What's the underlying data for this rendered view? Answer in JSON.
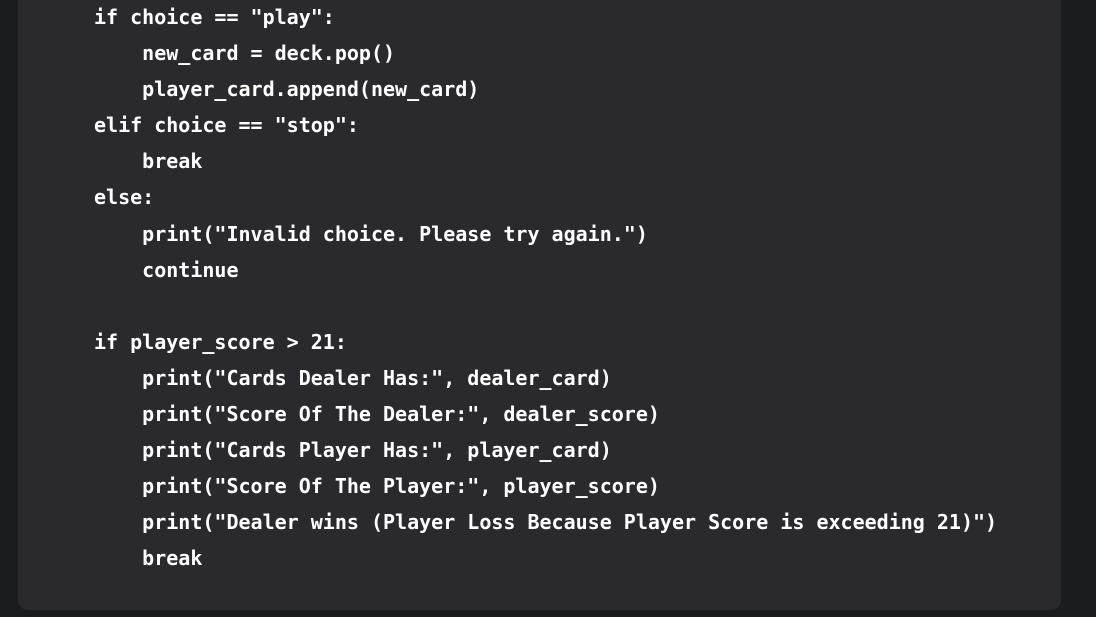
{
  "code": {
    "lines": [
      "if choice == \"play\":",
      "    new_card = deck.pop()",
      "    player_card.append(new_card)",
      "elif choice == \"stop\":",
      "    break",
      "else:",
      "    print(\"Invalid choice. Please try again.\")",
      "    continue",
      "",
      "if player_score > 21:",
      "    print(\"Cards Dealer Has:\", dealer_card)",
      "    print(\"Score Of The Dealer:\", dealer_score)",
      "    print(\"Cards Player Has:\", player_card)",
      "    print(\"Score Of The Player:\", player_score)",
      "    print(\"Dealer wins (Player Loss Because Player Score is exceeding 21)\")",
      "    break"
    ]
  },
  "colors": {
    "page_background": "#1b1c20",
    "panel_background": "#2a2a2e",
    "text": "#ffffff"
  }
}
